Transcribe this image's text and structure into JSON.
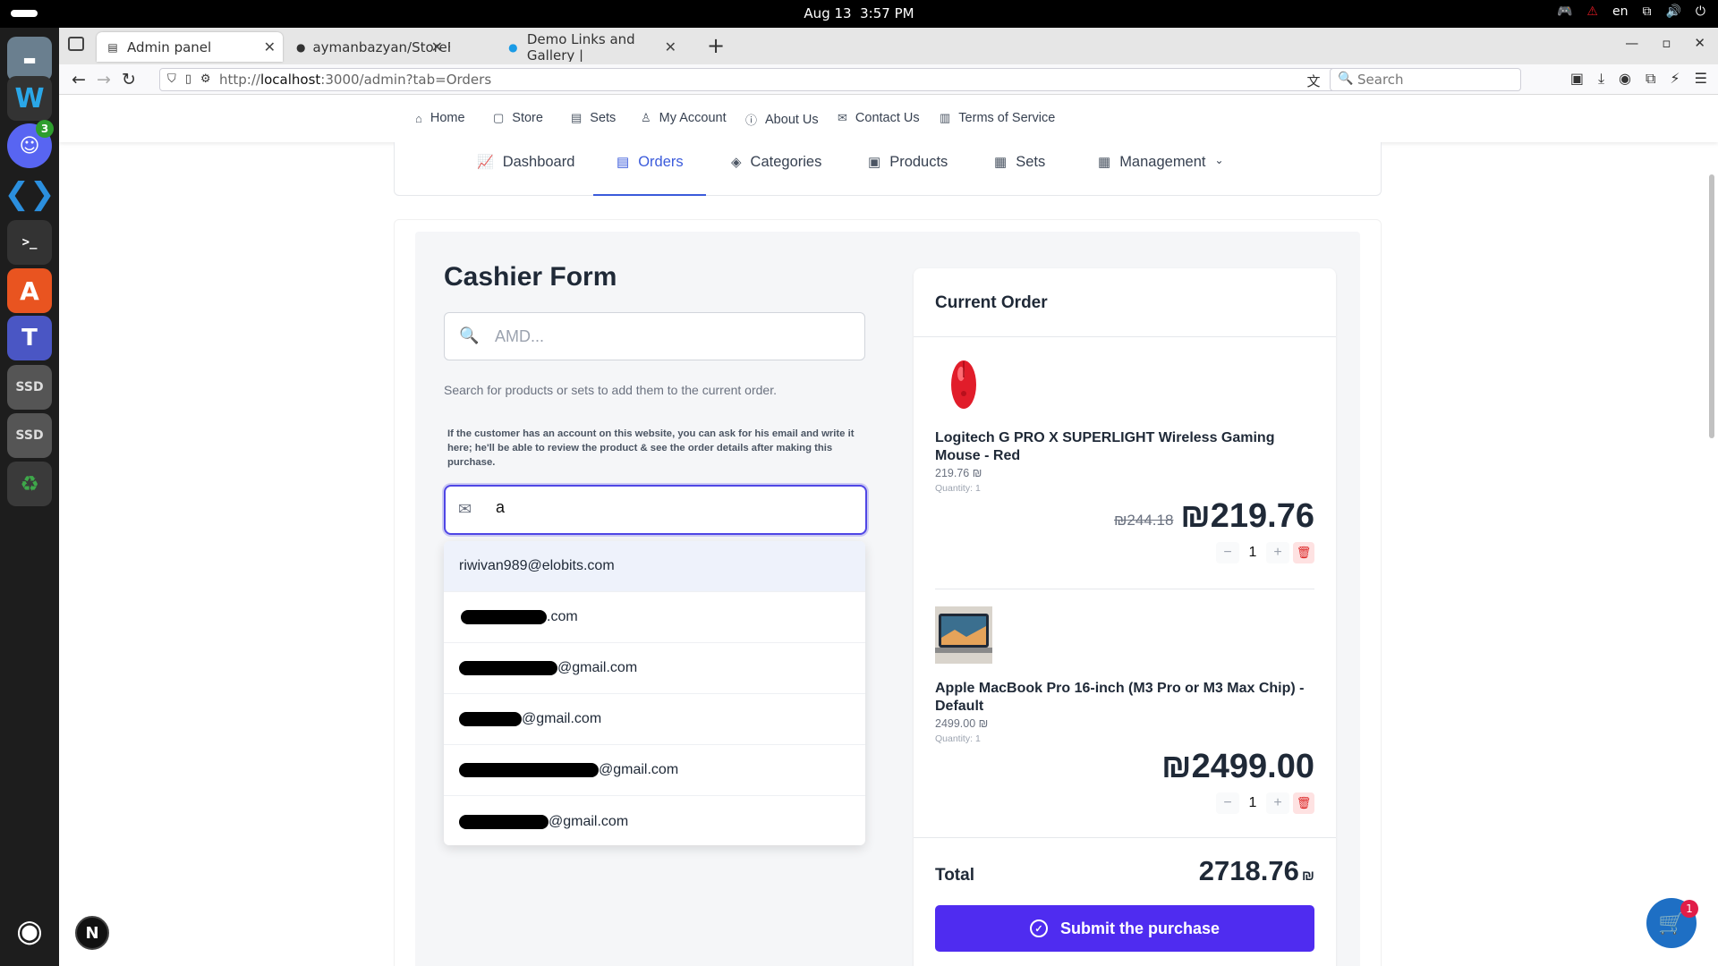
{
  "os": {
    "date": "Aug 13",
    "time": "3:57 PM",
    "language": "en"
  },
  "dock": {
    "discord_badge": "3",
    "ssd_label": "SSD"
  },
  "browser": {
    "tabs": [
      {
        "title": "Admin panel",
        "active": true
      },
      {
        "title": "aymanbazyan/StoreFlow·",
        "active": false
      },
      {
        "title": "Demo Links and Gallery |",
        "active": false
      }
    ],
    "url_prefix": "http://",
    "url_host": "localhost",
    "url_rest": ":3000/admin?tab=Orders",
    "search_placeholder": "Search"
  },
  "site_nav": [
    {
      "label": "Home",
      "icon": "home-icon"
    },
    {
      "label": "Store",
      "icon": "bag-icon"
    },
    {
      "label": "Sets",
      "icon": "receipt-icon"
    },
    {
      "label": "My Account",
      "icon": "user-icon"
    },
    {
      "label": "About Us",
      "icon": "info-icon"
    },
    {
      "label": "Contact Us",
      "icon": "mail-icon"
    },
    {
      "label": "Terms of Service",
      "icon": "document-icon"
    }
  ],
  "admin_tabs": [
    {
      "label": "Dashboard",
      "icon": "chart-line-icon"
    },
    {
      "label": "Orders",
      "icon": "clipboard-icon",
      "active": true
    },
    {
      "label": "Categories",
      "icon": "shapes-icon"
    },
    {
      "label": "Products",
      "icon": "archive-icon"
    },
    {
      "label": "Sets",
      "icon": "table-icon"
    },
    {
      "label": "Management",
      "icon": "grid-icon"
    }
  ],
  "cashier": {
    "title": "Cashier Form",
    "search_placeholder": "AMD...",
    "search_help": "Search for products or sets to add them to the current order.",
    "email_help": "If the customer has an account on this website, you can ask for his email and write it here; he'll be able to review the product & see the order details after making this purchase.",
    "email_value": "a",
    "suggestions": [
      {
        "text": "riwivan989@elobits.com"
      },
      {
        "text": ".com"
      },
      {
        "text": "@gmail.com"
      },
      {
        "text": "@gmail.com"
      },
      {
        "text": "@gmail.com"
      },
      {
        "text": "@gmail.com"
      }
    ]
  },
  "order": {
    "title": "Current Order",
    "items": [
      {
        "name": "Logitech G PRO X SUPERLIGHT Wireless Gaming Mouse - Red",
        "unit_price": "219.76 ₪",
        "quantity_label": "Quantity: 1",
        "old_price": "₪244.18",
        "price": "₪219.76",
        "qty": "1",
        "minus": "−",
        "plus": "+"
      },
      {
        "name": "Apple MacBook Pro 16-inch (M3 Pro or M3 Max Chip) - Default",
        "unit_price": "2499.00 ₪",
        "quantity_label": "Quantity: 1",
        "old_price": "",
        "price": "₪2499.00",
        "qty": "1",
        "minus": "−",
        "plus": "+"
      }
    ],
    "total_label": "Total",
    "total_value": "2718.76",
    "total_currency": "₪",
    "submit_label": "Submit the purchase"
  },
  "floating": {
    "next_badge": "N",
    "cart_count": "1"
  },
  "colors": {
    "accent": "#4f46e5",
    "submit": "#4f2cf0",
    "active_tab": "#3b5bdb",
    "delete": "#dc2626"
  }
}
